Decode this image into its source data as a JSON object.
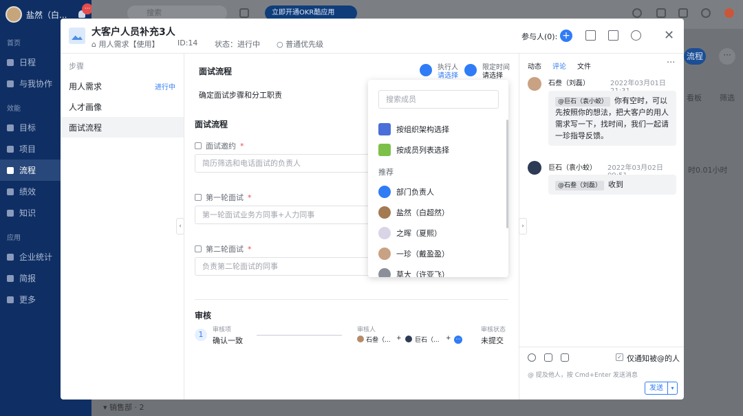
{
  "sidebar": {
    "user": "盐然（白...",
    "badge": "···",
    "sections": [
      "首页",
      "效能",
      "应用"
    ],
    "items_home": [
      "日程",
      "与我协作"
    ],
    "items_eff": [
      "目标",
      "项目",
      "流程",
      "绩效",
      "知识"
    ],
    "items_app": [
      "企业统计",
      "简报",
      "更多"
    ],
    "bottom": "▾  销售部 · 2"
  },
  "topbar": {
    "search_placeholder": "搜索",
    "okr_label": "立即开通OKR酷应用"
  },
  "background": {
    "flow_button": "流程",
    "more": "···",
    "board": "看板",
    "filter": "筛选",
    "time": "时0.01小时"
  },
  "modal": {
    "title": "大客户人员补充3人",
    "type": "用人需求【使用】",
    "id": "ID:14",
    "status": "状态：进行中",
    "priority": "普通优先级",
    "participants": "参与人(0):",
    "close": "✕"
  },
  "steps": {
    "heading": "步骤",
    "items": [
      {
        "label": "用人需求",
        "status": "进行中"
      },
      {
        "label": "人才画像",
        "status": ""
      },
      {
        "label": "面试流程",
        "status": ""
      }
    ]
  },
  "form": {
    "section_title": "面试流程",
    "executor_label": "执行人",
    "executor_value": "请选择",
    "deadline_label": "限定时间",
    "deadline_value": "请选择",
    "description": "确定面试步骤和分工职责",
    "sub_title": "面试流程",
    "fields": [
      {
        "label": "面试邀约",
        "placeholder": "简历筛选和电话面试的负责人"
      },
      {
        "label": "第一轮面试",
        "placeholder": "第一轮面试业务方同事+人力同事"
      },
      {
        "label": "第二轮面试",
        "placeholder": "负责第二轮面试的同事"
      }
    ],
    "required_mark": "*"
  },
  "review": {
    "title": "审核",
    "num": "1",
    "item_label": "审核项",
    "item_value": "确认一致",
    "reviewer_label": "审核人",
    "reviewer_1": "石叁（...",
    "reviewer_2": "巨石（...",
    "plus": "+",
    "status_label": "审核状态",
    "status_value": "未提交"
  },
  "dropdown": {
    "search_placeholder": "搜索成员",
    "by_org": "按组织架构选择",
    "by_list": "按成员列表选择",
    "recommend": "推荐",
    "members": [
      "部门负责人",
      "盐然（白超然）",
      "之晖（夏熙）",
      "一珍（戴盈盈）",
      "草大（许亚飞）"
    ]
  },
  "comments": {
    "tabs": [
      "动态",
      "评论",
      "文件"
    ],
    "more": "···",
    "items": [
      {
        "name": "石叁（刘磊）",
        "time": "2022年03月01日 21:31",
        "mention": "@巨石（袁小蛟）",
        "text": "你有空时，可以先按照你的想法，把大客户的用人需求写一下，找时间，我们一起请一珍指导反馈。"
      },
      {
        "name": "巨石（袁小蛟）",
        "time": "2022年03月02日 09:51",
        "mention": "@石叁（刘磊）",
        "text": "收到"
      }
    ],
    "notify_label": "仅通知被@的人",
    "placeholder": "@ 提及他人，按 Cmd+Enter 发送消息",
    "send": "发送"
  }
}
